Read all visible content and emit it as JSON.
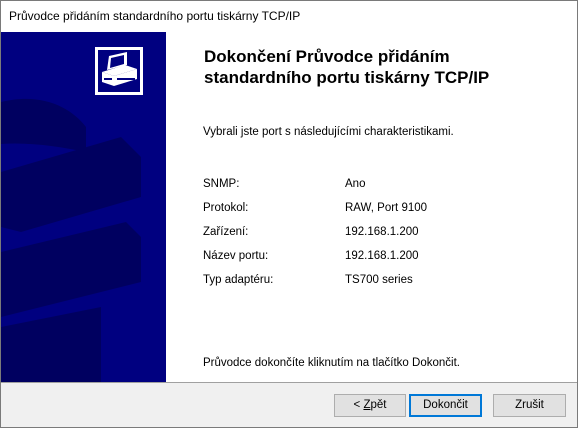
{
  "window": {
    "title": "Průvodce přidáním standardního portu tiskárny TCP/IP"
  },
  "banner": {
    "icon": "printer-icon",
    "colors": {
      "background": "#000080",
      "graphic_dark": "#000060",
      "graphic_light": "#ffffff"
    }
  },
  "content": {
    "heading_line1": "Dokončení Průvodce přidáním",
    "heading_line2": "standardního portu tiskárny TCP/IP",
    "intro": "Vybrali jste port s následujícími charakteristikami.",
    "properties": [
      {
        "label": "SNMP:",
        "value": "Ano"
      },
      {
        "label": "Protokol:",
        "value": "RAW, Port 9100"
      },
      {
        "label": "Zařízení:",
        "value": "192.168.1.200"
      },
      {
        "label": "Název portu:",
        "value": "192.168.1.200"
      },
      {
        "label": "Typ adaptéru:",
        "value": "TS700 series"
      }
    ],
    "finish_note": "Průvodce dokončíte kliknutím na tlačítko Dokončit."
  },
  "buttons": {
    "back_prefix": "< ",
    "back_mnemonic": "Z",
    "back_rest": "pět",
    "finish": "Dokončit",
    "cancel": "Zrušit"
  }
}
